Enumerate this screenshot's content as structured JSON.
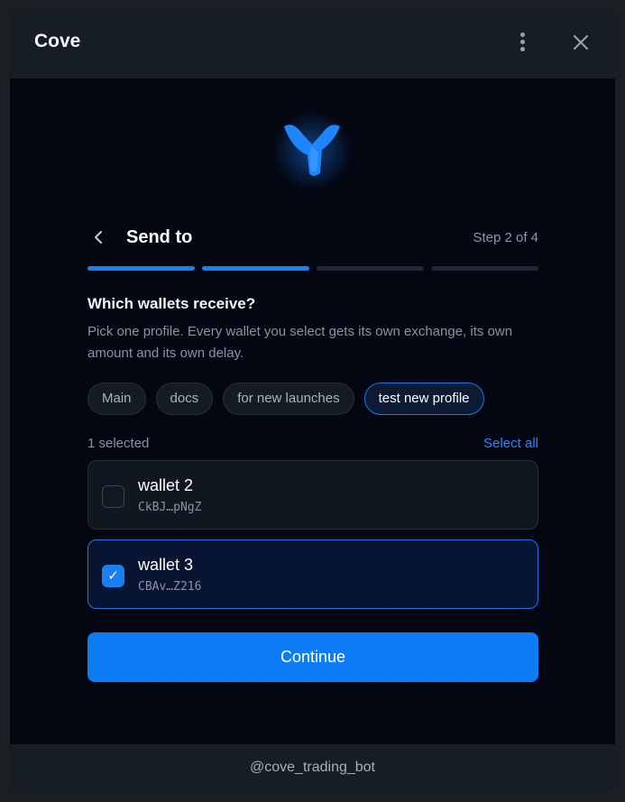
{
  "window": {
    "title": "Cove",
    "footer_text": "@cove_trading_bot"
  },
  "icons": {
    "menu": "more-vertical-icon",
    "close": "close-icon",
    "back": "chevron-left-icon",
    "logo": "cove-logo-icon",
    "check": "checkmark-icon"
  },
  "colors": {
    "accent": "#1a7ff0",
    "background": "#030712",
    "panel": "#171d25"
  },
  "header": {
    "title": "Send to",
    "step": "Step 2 of 4",
    "progress_total": 4,
    "progress_current": 2
  },
  "section": {
    "question": "Which wallets receive?",
    "description": "Pick one profile. Every wallet you select gets its own exchange, its own amount and its own delay."
  },
  "profiles": [
    {
      "label": "Main",
      "active": false
    },
    {
      "label": "docs",
      "active": false
    },
    {
      "label": "for new launches",
      "active": false
    },
    {
      "label": "test new profile",
      "active": true
    }
  ],
  "selection": {
    "count_text": "1 selected",
    "select_all_label": "Select all"
  },
  "wallets": [
    {
      "name": "wallet 2",
      "address": "CkBJ…pNgZ",
      "checked": false
    },
    {
      "name": "wallet 3",
      "address": "CBAv…Z216",
      "checked": true
    }
  ],
  "actions": {
    "continue_label": "Continue",
    "check_glyph": "✓"
  }
}
